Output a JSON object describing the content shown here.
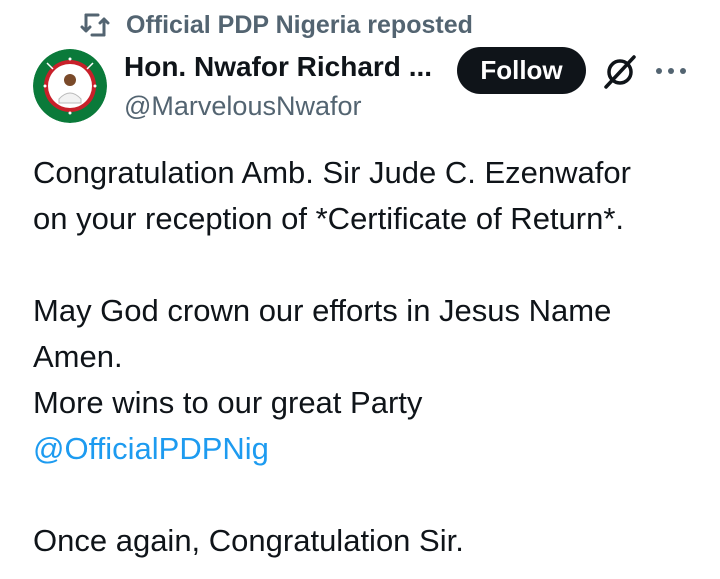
{
  "repost": {
    "icon": "repost-icon",
    "text": "Official PDP Nigeria reposted"
  },
  "author": {
    "name": "Hon. Nwafor Richard ...",
    "handle": "@MarvelousNwafor",
    "avatar_text": "AMB. SIR JUDE C. EZENWAFOR",
    "avatar_ring_text": "SENATOR OF ANAMBRA STATE"
  },
  "actions": {
    "follow_label": "Follow",
    "grok_icon": "grok-icon",
    "more_icon": "more-options-icon"
  },
  "tweet": {
    "line1": "Congratulation Amb. Sir  Jude C. Ezenwafor",
    "line2": "on your reception of *Certificate of Return*.",
    "line3": "May God crown our efforts in Jesus Name",
    "line4": "Amen.",
    "line5": "More wins to our great Party",
    "mention": "@OfficialPDPNig",
    "line6": "Once again, Congratulation Sir."
  },
  "colors": {
    "text": "#0f1419",
    "secondary": "#536471",
    "link": "#1d9bf0",
    "button_bg": "#0f1419",
    "avatar_green": "#0a7a3a",
    "avatar_red": "#c8202a"
  }
}
